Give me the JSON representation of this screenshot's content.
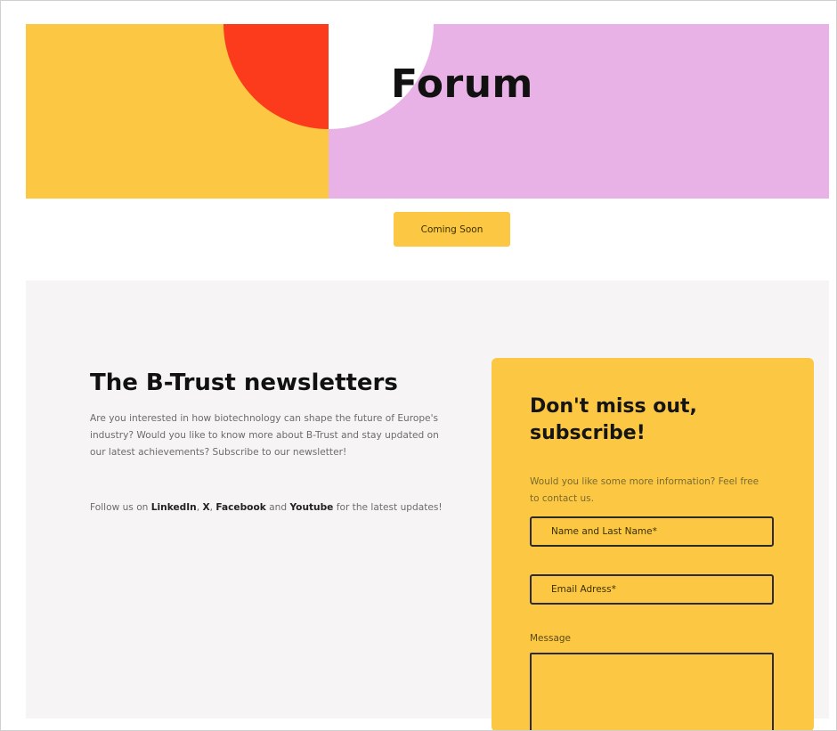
{
  "hero": {
    "title": "Forum",
    "colors": {
      "left": "#fcc844",
      "right": "#e8b2e6",
      "circle_red": "#fb3b1b",
      "circle_white": "#ffffff"
    }
  },
  "coming_soon_label": "Coming Soon",
  "newsletter": {
    "title": "The B-Trust newsletters",
    "description": "Are you interested in how biotechnology can shape the future of Europe's industry? Would you like to know more about B-Trust and stay updated on our latest achievements? Subscribe to our newsletter!",
    "follow_prefix": "Follow us on ",
    "links": {
      "linkedin": "LinkedIn",
      "x": "X",
      "facebook": "Facebook",
      "youtube": "Youtube"
    },
    "sep_comma": ", ",
    "sep_and": " and ",
    "follow_suffix": " for the latest updates!"
  },
  "subscribe": {
    "title": "Don't miss out, subscribe!",
    "info": "Would you like some more information? Feel free to contact us.",
    "name_placeholder": "Name and Last Name*",
    "email_placeholder": "Email Adress*",
    "message_label": "Message",
    "accent": "#fcc844"
  }
}
